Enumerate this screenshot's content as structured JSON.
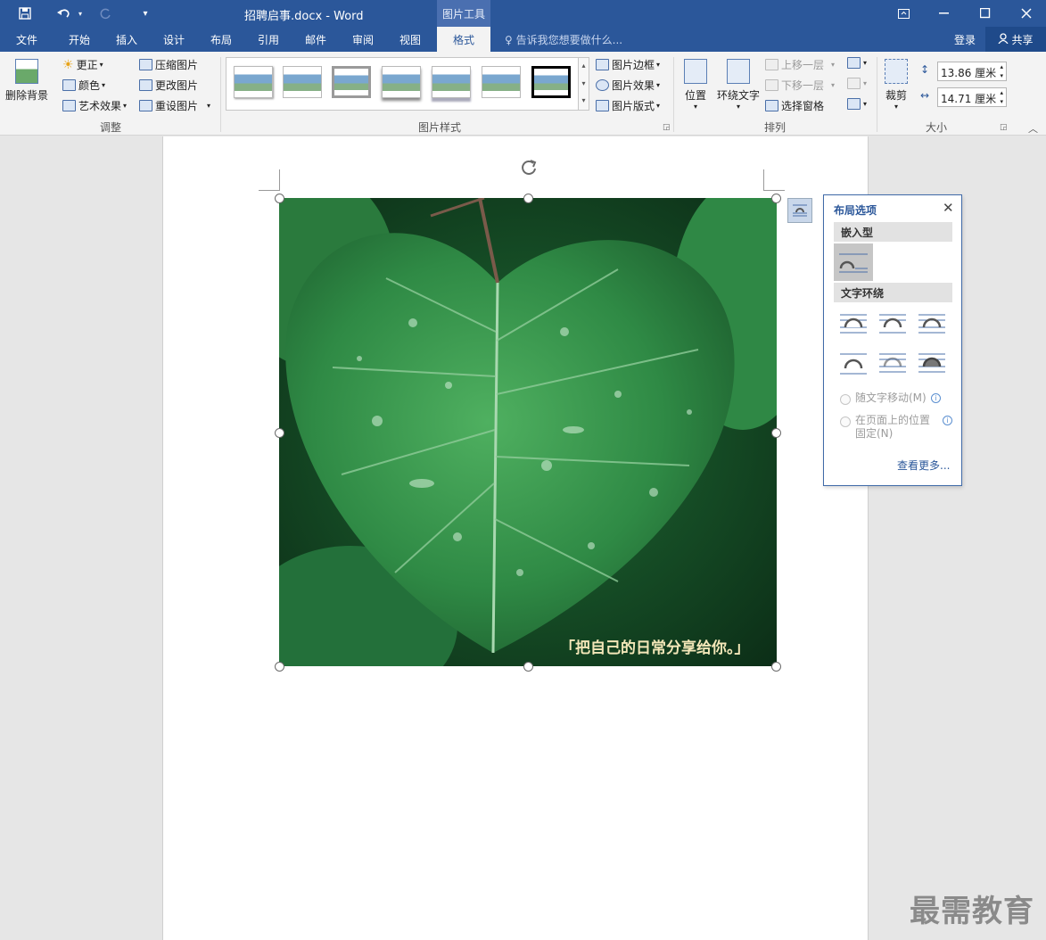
{
  "titlebar": {
    "doc_title": "招聘启事.docx - Word",
    "context_title": "图片工具",
    "qat_save_icon": "save-icon",
    "qat_undo_icon": "undo-icon",
    "qat_redo_icon": "redo-icon",
    "qat_customize_icon": "customize-qat-icon"
  },
  "tabs": [
    {
      "label": "文件"
    },
    {
      "label": "开始"
    },
    {
      "label": "插入"
    },
    {
      "label": "设计"
    },
    {
      "label": "布局"
    },
    {
      "label": "引用"
    },
    {
      "label": "邮件"
    },
    {
      "label": "审阅"
    },
    {
      "label": "视图"
    },
    {
      "label": "格式"
    }
  ],
  "tell_me": "告诉我您想要做什么...",
  "account": {
    "login": "登录",
    "share": "共享"
  },
  "ribbon": {
    "adjust": {
      "remove_bg": "删除背景",
      "corrections": "更正",
      "color": "颜色",
      "artistic": "艺术效果",
      "compress": "压缩图片",
      "change": "更改图片",
      "reset": "重设图片",
      "label": "调整"
    },
    "styles": {
      "border": "图片边框",
      "effects": "图片效果",
      "layout": "图片版式",
      "label": "图片样式"
    },
    "arrange": {
      "position": "位置",
      "wrap": "环绕文字",
      "forward": "上移一层",
      "backward": "下移一层",
      "pane": "选择窗格",
      "label": "排列"
    },
    "size": {
      "crop": "裁剪",
      "height": "13.86 厘米",
      "width": "14.71 厘米",
      "label": "大小"
    }
  },
  "image": {
    "caption": "「把自己的日常分享给你。」"
  },
  "layout_panel": {
    "title": "布局选项",
    "inline_section": "嵌入型",
    "wrap_section": "文字环绕",
    "move_with_text": "随文字移动(M)",
    "fix_position_1": "在页面上的位置",
    "fix_position_2": "固定(N)",
    "see_more": "查看更多..."
  },
  "watermark": "最需教育",
  "colors": {
    "title_bar": "#2b579a",
    "ribbon": "#f3f3f3",
    "link": "#2b579a"
  }
}
